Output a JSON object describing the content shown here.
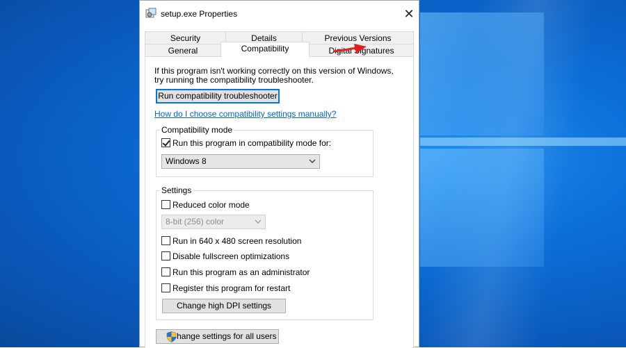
{
  "window": {
    "title": "setup.exe Properties"
  },
  "tabs": {
    "row1": [
      {
        "label": "Security"
      },
      {
        "label": "Details"
      },
      {
        "label": "Previous Versions"
      }
    ],
    "row2": [
      {
        "label": "General"
      },
      {
        "label": "Compatibility",
        "active": true
      },
      {
        "label": "Digital Signatures"
      }
    ]
  },
  "intro": {
    "line1": "If this program isn't working correctly on this version of Windows,",
    "line2": "try running the compatibility troubleshooter."
  },
  "troubleshooter_button": "Run compatibility troubleshooter",
  "manual_link": "How do I choose compatibility settings manually?",
  "compat_mode": {
    "title": "Compatibility mode",
    "checkbox_label": "Run this program in compatibility mode for:",
    "checked": true,
    "selected": "Windows 8"
  },
  "settings": {
    "title": "Settings",
    "reduced_color": {
      "label": "Reduced color mode",
      "checked": false
    },
    "color_select": "8-bit (256) color",
    "res_640": {
      "label": "Run in 640 x 480 screen resolution",
      "checked": false
    },
    "fullscreen": {
      "label": "Disable fullscreen optimizations",
      "checked": false
    },
    "admin": {
      "label": "Run this program as an administrator",
      "checked": false
    },
    "restart": {
      "label": "Register this program for restart",
      "checked": false
    },
    "dpi_button": "Change high DPI settings"
  },
  "all_users_button": "Change settings for all users",
  "colors": {
    "accent": "#0078d7",
    "link": "#0066cc",
    "arrow": "#e02020"
  }
}
